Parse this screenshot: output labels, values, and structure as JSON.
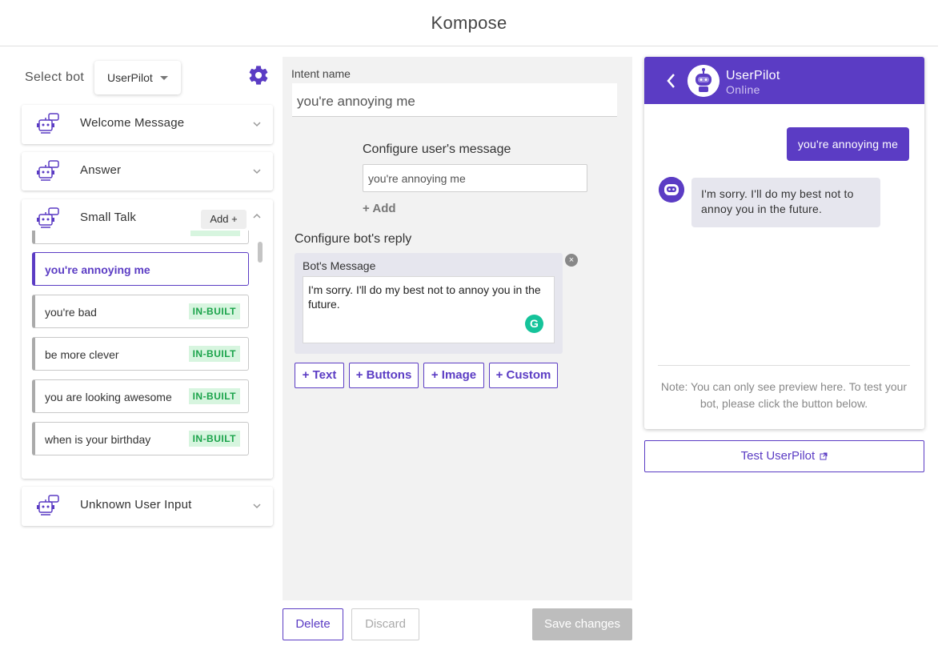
{
  "app": {
    "title": "Kompose"
  },
  "bot_selector": {
    "label": "Select bot",
    "selected": "UserPilot"
  },
  "sections": {
    "welcome": "Welcome Message",
    "answer": "Answer",
    "small_talk": "Small Talk",
    "unknown": "Unknown User Input",
    "add_label": "Add +"
  },
  "small_talk_items": [
    {
      "label": "you're annoying me",
      "badge": ""
    },
    {
      "label": "you're bad",
      "badge": "IN-BUILT"
    },
    {
      "label": "be more clever",
      "badge": "IN-BUILT"
    },
    {
      "label": "you are looking awesome",
      "badge": "IN-BUILT"
    },
    {
      "label": "when is your birthday",
      "badge": "IN-BUILT"
    }
  ],
  "editor": {
    "intent_label": "Intent name",
    "intent_value": "you're annoying me",
    "user_msg_label": "Configure user's message",
    "user_msg_value": "you're annoying me",
    "add_link": "+ Add",
    "bot_reply_label": "Configure bot's reply",
    "bot_msg_title": "Bot's Message",
    "bot_msg_value": "I'm sorry. I'll do my best not to annoy you in the future.",
    "options": {
      "text": "+ Text",
      "buttons": "+ Buttons",
      "image": "+ Image",
      "custom": "+ Custom"
    },
    "close_symbol": "×",
    "grammarly_symbol": "G"
  },
  "actions": {
    "delete": "Delete",
    "discard": "Discard",
    "save": "Save changes"
  },
  "preview": {
    "bot_name": "UserPilot",
    "status": "Online",
    "user_message": "you're annoying me",
    "bot_message": "I'm sorry. I'll do my best not to annoy you in the future.",
    "note": "Note: You can only see preview here. To test your bot, please click the button below.",
    "test_button": "Test UserPilot"
  },
  "colors": {
    "accent": "#5b3cc4",
    "badge_bg": "#d7f5df",
    "badge_text": "#1aa34a"
  }
}
